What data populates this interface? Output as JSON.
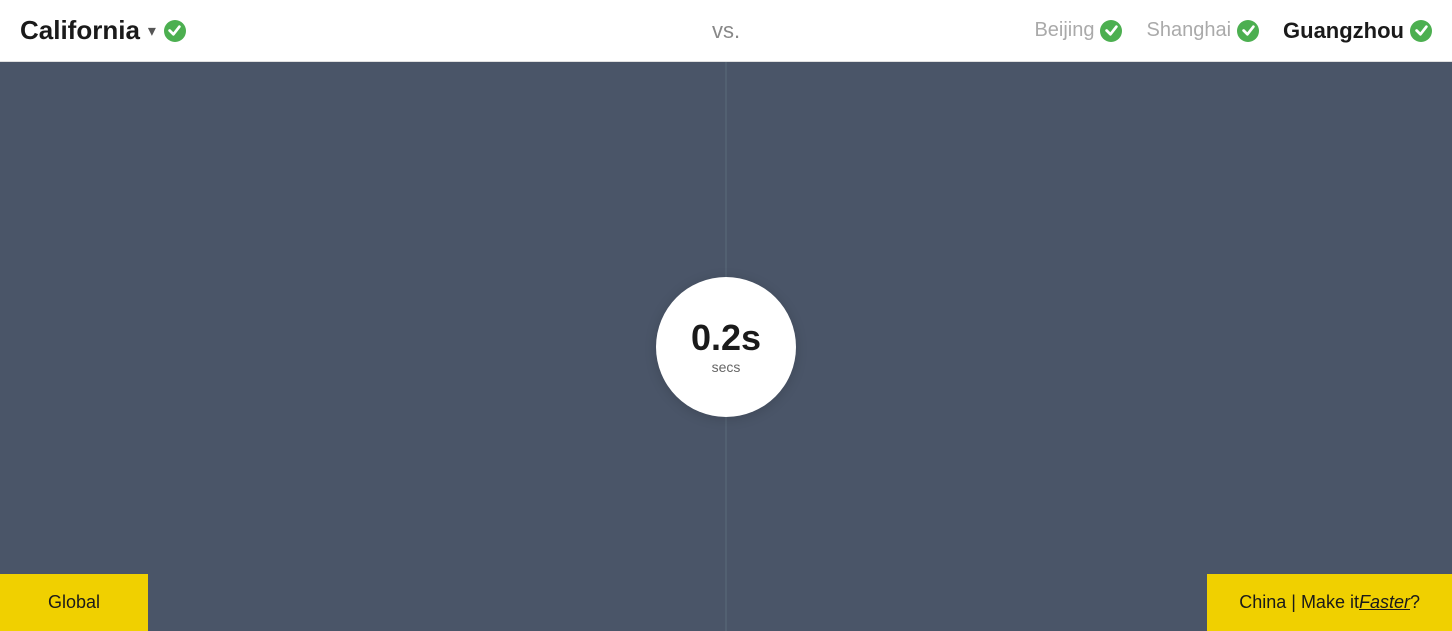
{
  "header": {
    "title": "California",
    "chevron": "▾",
    "vs_label": "vs.",
    "locations": [
      {
        "id": "beijing",
        "label": "Beijing",
        "active": false
      },
      {
        "id": "shanghai",
        "label": "Shanghai",
        "active": false
      },
      {
        "id": "guangzhou",
        "label": "Guangzhou",
        "active": true
      }
    ]
  },
  "main": {
    "timer": {
      "value": "0.2s",
      "unit": "secs"
    },
    "btn_global": "Global",
    "btn_china_prefix": "China | Make it ",
    "btn_china_link": "Faster",
    "btn_china_suffix": "?"
  }
}
